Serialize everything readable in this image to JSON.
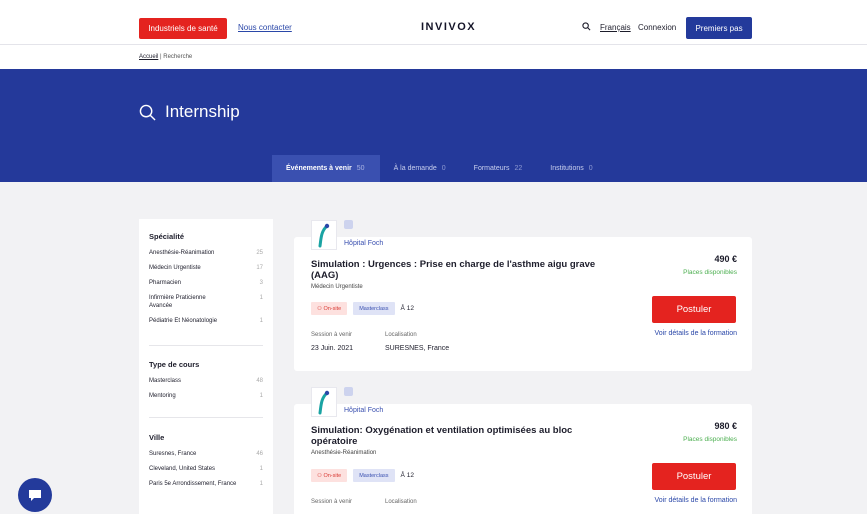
{
  "topbar": {
    "industry_btn": "Industriels de santé",
    "contact": "Nous contacter",
    "logo": "INVIVOX",
    "lang": "Français",
    "login": "Connexion",
    "first_steps": "Premiers pas"
  },
  "breadcrumb": {
    "home": "Accueil",
    "sep": " | ",
    "current": "Recherche"
  },
  "hero": {
    "query": "Internship"
  },
  "tabs": [
    {
      "label": "Événements à venir",
      "count": "50"
    },
    {
      "label": "À la demande",
      "count": "0"
    },
    {
      "label": "Formateurs",
      "count": "22"
    },
    {
      "label": "Institutions",
      "count": "0"
    }
  ],
  "filters": {
    "specialty": {
      "title": "Spécialité",
      "items": [
        {
          "label": "Anesthésie-Réanimation",
          "count": "25"
        },
        {
          "label": "Médecin Urgentiste",
          "count": "17"
        },
        {
          "label": "Pharmacien",
          "count": "3"
        },
        {
          "label": "Infirmière Praticienne Avancée",
          "count": "1"
        },
        {
          "label": "Pédiatrie Et Néonatologie",
          "count": "1"
        }
      ]
    },
    "course_type": {
      "title": "Type de cours",
      "items": [
        {
          "label": "Masterclass",
          "count": "48"
        },
        {
          "label": "Mentoring",
          "count": "1"
        }
      ]
    },
    "city": {
      "title": "Ville",
      "items": [
        {
          "label": "Suresnes, France",
          "count": "46"
        },
        {
          "label": "Cleveland, United States",
          "count": "1"
        },
        {
          "label": "Paris 5e Arrondissement, France",
          "count": "1"
        }
      ]
    }
  },
  "events": [
    {
      "org": "Hôpital Foch",
      "title": "Simulation : Urgences : Prise en charge de l'asthme aigu grave (AAG)",
      "specialty": "Médecin Urgentiste",
      "tag_onsite": "On-site",
      "tag_type": "Masterclass",
      "seats": "12",
      "session_label": "Session à venir",
      "session_date": "23 Juin. 2021",
      "location_label": "Localisation",
      "location": "SURESNES, France",
      "price": "490 €",
      "availability": "Places disponibles",
      "apply": "Postuler",
      "details": "Voir détails de la formation"
    },
    {
      "org": "Hôpital Foch",
      "title": "Simulation: Oxygénation et ventilation optimisées au bloc opératoire",
      "specialty": "Anesthésie-Réanimation",
      "tag_onsite": "On-site",
      "tag_type": "Masterclass",
      "seats": "12",
      "session_label": "Session à venir",
      "location_label": "Localisation",
      "price": "980 €",
      "availability": "Places disponibles",
      "apply": "Postuler",
      "details": "Voir détails de la formation"
    }
  ],
  "colors": {
    "brand_blue": "#24399a",
    "accent_red": "#e4231f",
    "available_green": "#4caf50"
  }
}
